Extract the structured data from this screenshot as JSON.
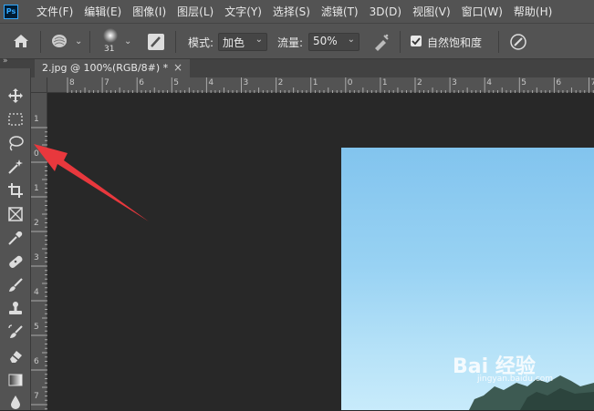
{
  "app": {
    "logo_text": "Ps"
  },
  "menu": {
    "items": [
      "文件(F)",
      "编辑(E)",
      "图像(I)",
      "图层(L)",
      "文字(Y)",
      "选择(S)",
      "滤镜(T)",
      "3D(D)",
      "视图(V)",
      "窗口(W)",
      "帮助(H)"
    ]
  },
  "options": {
    "brush_size": "31",
    "mode_label": "模式:",
    "mode_value": "加色",
    "flow_label": "流量:",
    "flow_value": "50%",
    "vibrance_label": "自然饱和度",
    "vibrance_checked": true
  },
  "toolbar": {
    "grip": "»",
    "tools": [
      "move-icon",
      "marquee-icon",
      "lasso-icon",
      "magic-wand-icon",
      "crop-icon",
      "frame-icon",
      "eyedropper-icon",
      "healing-brush-icon",
      "brush-icon",
      "stamp-icon",
      "history-brush-icon",
      "eraser-icon",
      "gradient-icon",
      "blur-icon"
    ]
  },
  "document": {
    "tab_title": "2.jpg @ 100%(RGB/8#) *",
    "close": "×"
  },
  "rulers": {
    "horizontal": [
      "8",
      "7",
      "6",
      "5",
      "4",
      "3",
      "2",
      "1",
      "0",
      "1",
      "2",
      "3",
      "4",
      "5",
      "6",
      "7"
    ],
    "vertical": [
      "1",
      "0",
      "1",
      "2",
      "3",
      "4",
      "5",
      "6",
      "7"
    ]
  },
  "watermark": {
    "text": "Bai 经验",
    "sub": "jingyan.baidu.com"
  },
  "colors": {
    "ui_dark": "#535353",
    "canvas": "#282828",
    "accent": "#e8383d",
    "sky": "#98d2f3"
  }
}
